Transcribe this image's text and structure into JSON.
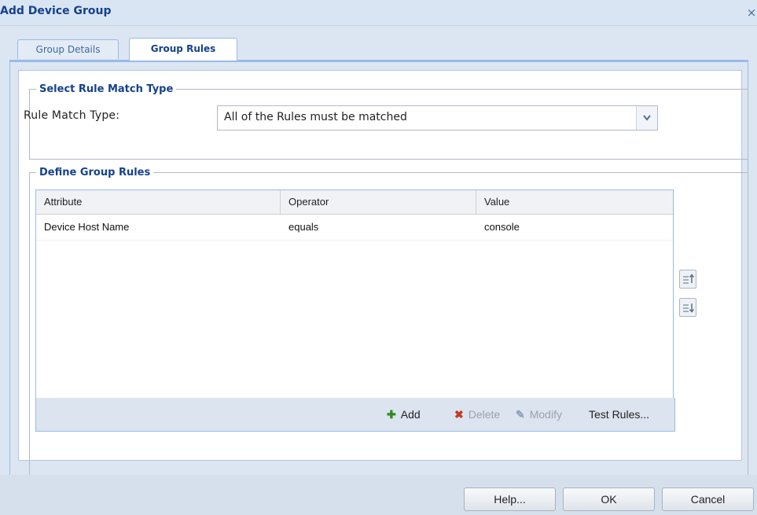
{
  "window": {
    "title": "Add Device Group",
    "close_glyph": "×"
  },
  "tabs": [
    {
      "label": "Group Details",
      "active": false
    },
    {
      "label": "Group Rules",
      "active": true
    }
  ],
  "match_section": {
    "legend": "Select Rule Match Type",
    "label": "Rule Match Type:",
    "selected_value": "All of the Rules must be matched"
  },
  "rules_section": {
    "legend": "Define Group Rules",
    "columns": [
      "Attribute",
      "Operator",
      "Value"
    ],
    "rows": [
      {
        "attribute": "Device Host Name",
        "operator": "equals",
        "value": "console"
      }
    ],
    "toolbar": {
      "add_label": "Add",
      "delete_label": "Delete",
      "modify_label": "Modify",
      "test_label": "Test Rules..."
    },
    "side_buttons": {
      "move_up_icon": "move-up-icon",
      "move_down_icon": "move-down-icon"
    }
  },
  "footer": {
    "help_label": "Help...",
    "ok_label": "OK",
    "cancel_label": "Cancel"
  },
  "colors": {
    "title_text": "#15428b",
    "panel_bg": "#dce6f2",
    "border": "#99bbe8",
    "add_icon": "#2f8a1f",
    "delete_icon": "#c23b22"
  }
}
